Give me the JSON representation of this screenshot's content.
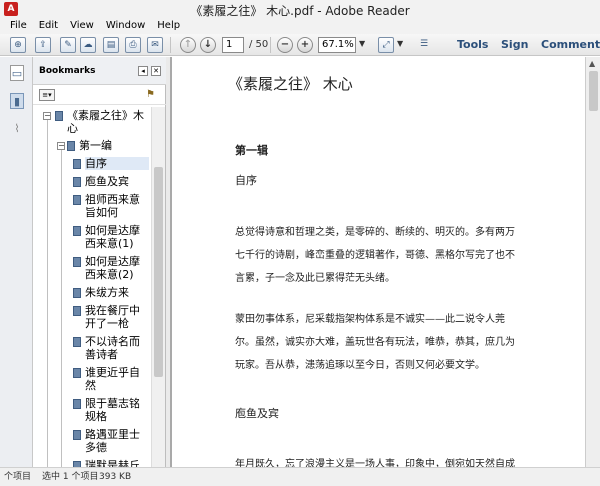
{
  "window": {
    "title": "《素履之往》 木心.pdf - Adobe Reader",
    "app_icon": "acrobat-icon"
  },
  "menu": [
    "File",
    "Edit",
    "View",
    "Window",
    "Help"
  ],
  "toolbar": {
    "page_current": "1",
    "page_total": "/ 50",
    "zoom": "67.1%",
    "tools": "Tools",
    "sign": "Sign",
    "comment": "Comment"
  },
  "bookmarks": {
    "title": "Bookmarks",
    "items": [
      {
        "label": "《素履之往》木心",
        "level": 0
      },
      {
        "label": "第一编",
        "level": 1
      },
      {
        "label": "自序",
        "level": 2,
        "selected": true
      },
      {
        "label": "庖鱼及宾",
        "level": 2
      },
      {
        "label": "祖师西来意旨如何",
        "level": 2
      },
      {
        "label": "如何是达摩西来意(1)",
        "level": 2
      },
      {
        "label": "如何是达摩西来意(2)",
        "level": 2
      },
      {
        "label": "朱绂方来",
        "level": 2
      },
      {
        "label": "我在餐厅中开了一枪",
        "level": 2
      },
      {
        "label": "不以诗名而善诗者",
        "level": 2
      },
      {
        "label": "谁更近乎自然",
        "level": 2
      },
      {
        "label": "限于墓志铭规格",
        "level": 2
      },
      {
        "label": "路遇亚里士多德",
        "level": 2
      },
      {
        "label": "瑞默是赫丘",
        "level": 2
      }
    ]
  },
  "document": {
    "heading": "《素履之往》 木心",
    "part": "第一辑",
    "section1": "自序",
    "para1": [
      "总觉得诗意和哲理之类，是零碎的、断续的、明灭的。多有两万",
      "七千行的诗剧，峰峦重叠的逻辑著作，哥德、黑格尔写完了也不",
      "言累，子一念及此已累得茫无头绪。"
    ],
    "para2": [
      "蒙田勿事体系，尼采载指架构体系是不诚实——此二说令人莞",
      "尔。虽然，诚实亦大难，盖玩世各有玩法，唯恭，恭其，庶几为",
      "玩家。吾从恭，漶荡追琢以至今日，否则又何必要文学。"
    ],
    "section2": "庖鱼及宾",
    "para3": [
      "年月既久，忘了浪漫主义是一场人事，印象中，倒宛如天然自成"
    ]
  },
  "status": {
    "items": "个项目",
    "selected": "选中 1 个项目",
    "size": "393 KB"
  }
}
